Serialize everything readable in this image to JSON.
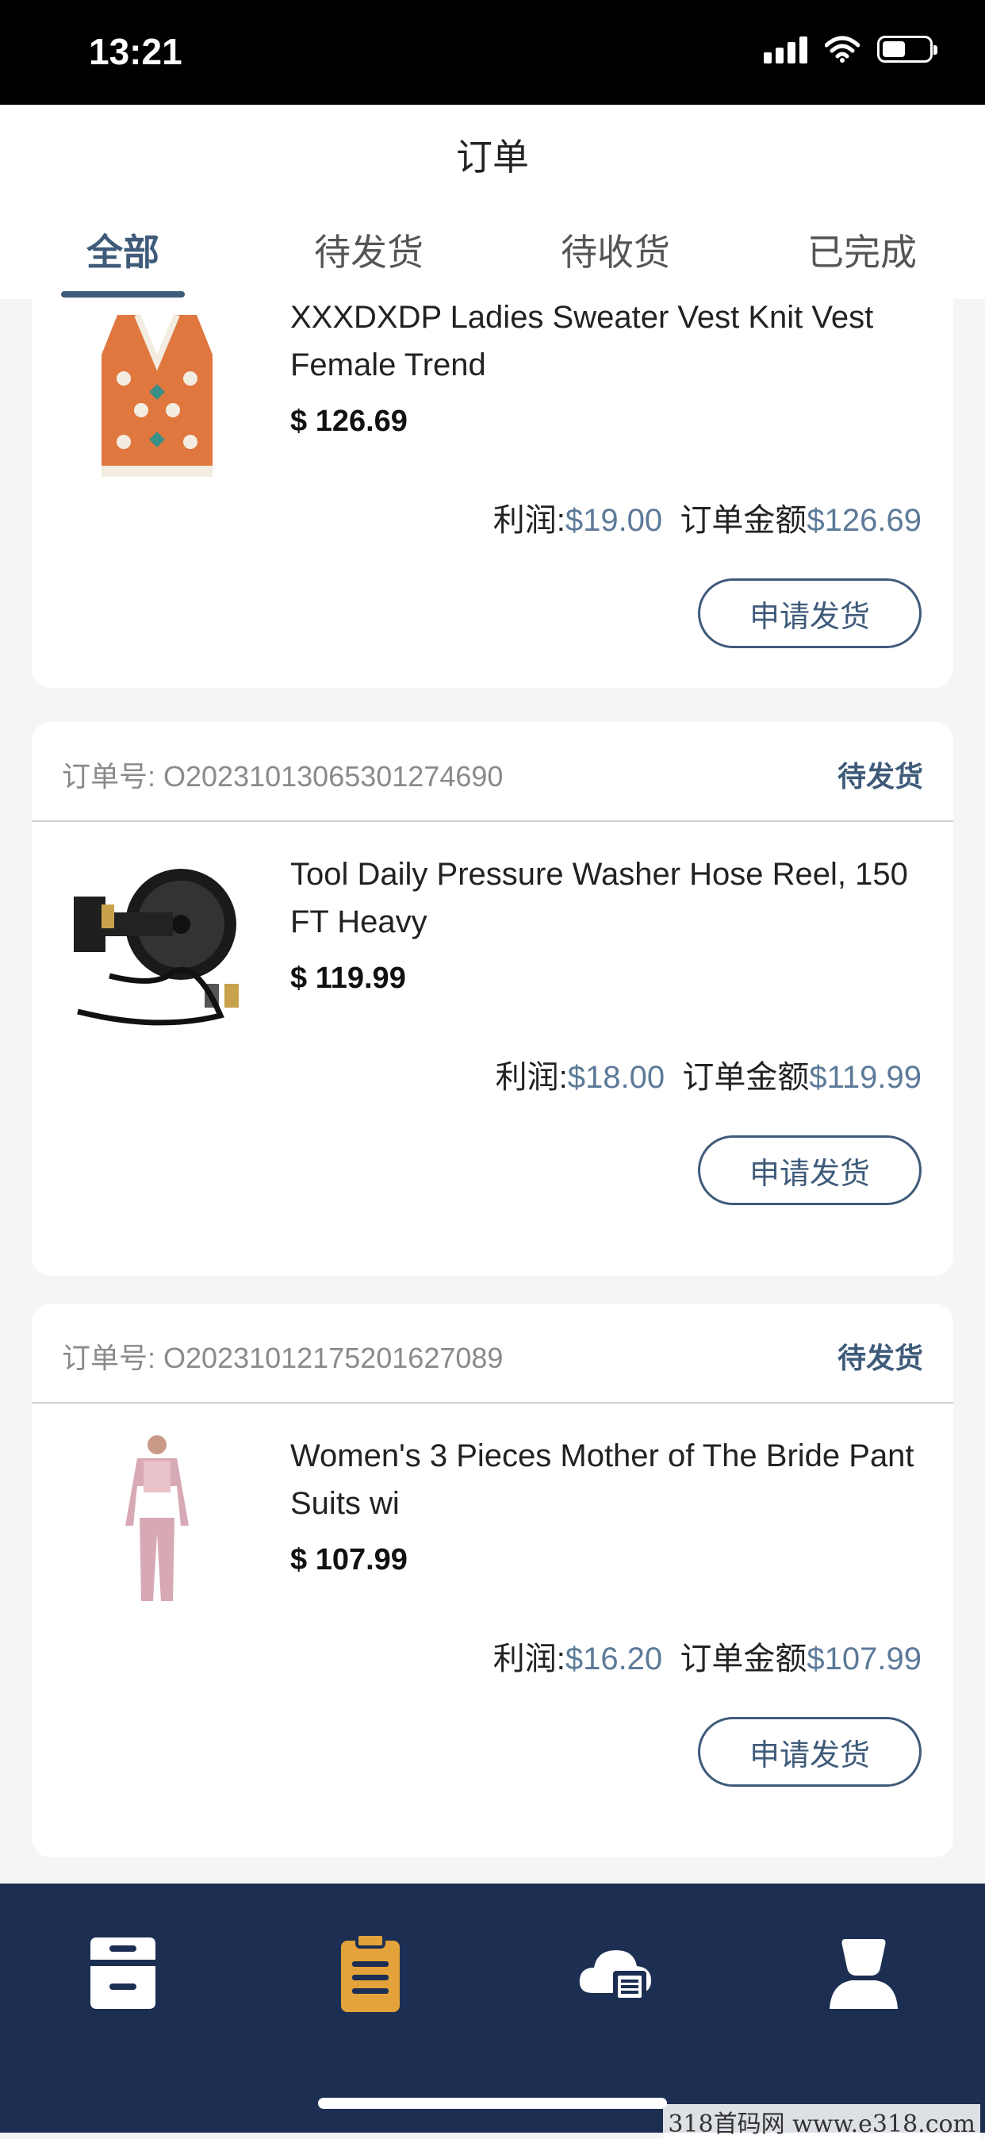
{
  "status_bar": {
    "time": "13:21"
  },
  "header": {
    "title": "订单",
    "tabs": [
      {
        "label": "全部",
        "active": true
      },
      {
        "label": "待发货",
        "active": false
      },
      {
        "label": "待收货",
        "active": false
      },
      {
        "label": "已完成",
        "active": false
      }
    ]
  },
  "orders": [
    {
      "order_no": "",
      "status": "",
      "product_name": "XXXDXDP Ladies Sweater Vest Knit Vest Female Trend",
      "price": "$ 126.69",
      "profit_label": "利润:",
      "profit": "$19.00",
      "amount_label": "订单金额",
      "amount": "$126.69",
      "button": "申请发货",
      "image_icon": "sweater-vest-image"
    },
    {
      "order_no": "订单号: O20231013065301274690",
      "status": "待发货",
      "product_name": "Tool Daily Pressure Washer Hose Reel, 150 FT Heavy",
      "price": "$ 119.99",
      "profit_label": "利润:",
      "profit": "$18.00",
      "amount_label": "订单金额",
      "amount": "$119.99",
      "button": "申请发货",
      "image_icon": "hose-reel-image"
    },
    {
      "order_no": "订单号: O20231012175201627089",
      "status": "待发货",
      "product_name": "Women's 3 Pieces Mother of The Bride Pant Suits wi",
      "price": "$ 107.99",
      "profit_label": "利润:",
      "profit": "$16.20",
      "amount_label": "订单金额",
      "amount": "$107.99",
      "button": "申请发货",
      "image_icon": "pant-suit-image"
    }
  ],
  "bottom_nav": [
    {
      "icon": "store-icon",
      "active": false
    },
    {
      "icon": "orders-clipboard-icon",
      "active": true
    },
    {
      "icon": "cloud-list-icon",
      "active": false
    },
    {
      "icon": "profile-icon",
      "active": false
    }
  ],
  "watermark": "318首码网 www.e318.com",
  "colors": {
    "accent": "#3f5b7a",
    "nav_bg": "#1c2f52",
    "active_icon": "#e3a33a",
    "value": "#5d7a99"
  }
}
